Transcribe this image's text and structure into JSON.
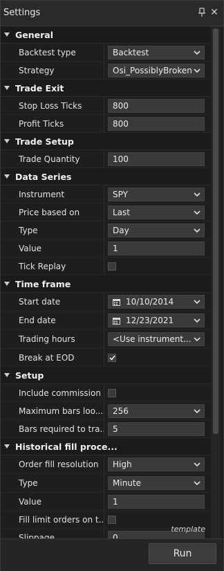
{
  "window": {
    "title": "Settings"
  },
  "sections": {
    "general": {
      "title": "General",
      "backtest_type": {
        "label": "Backtest type",
        "value": "Backtest"
      },
      "strategy": {
        "label": "Strategy",
        "value": "Osi_PossiblyBroken"
      }
    },
    "trade_exit": {
      "title": "Trade Exit",
      "stop_loss": {
        "label": "Stop Loss Ticks",
        "value": "800"
      },
      "profit": {
        "label": "Profit Ticks",
        "value": "800"
      }
    },
    "trade_setup": {
      "title": "Trade Setup",
      "quantity": {
        "label": "Trade Quantity",
        "value": "100"
      }
    },
    "data_series": {
      "title": "Data Series",
      "instrument": {
        "label": "Instrument",
        "value": "SPY"
      },
      "price_based_on": {
        "label": "Price based on",
        "value": "Last"
      },
      "type": {
        "label": "Type",
        "value": "Day"
      },
      "value": {
        "label": "Value",
        "value": "1"
      },
      "tick_replay": {
        "label": "Tick Replay",
        "checked": false
      }
    },
    "time_frame": {
      "title": "Time frame",
      "start_date": {
        "label": "Start date",
        "value": "10/10/2014"
      },
      "end_date": {
        "label": "End date",
        "value": "12/23/2021"
      },
      "trading_hours": {
        "label": "Trading hours",
        "value": "<Use instrument..."
      },
      "break_eod": {
        "label": "Break at EOD",
        "checked": true
      }
    },
    "setup": {
      "title": "Setup",
      "include_commission": {
        "label": "Include commission",
        "checked": false
      },
      "max_bars": {
        "label": "Maximum bars loo...",
        "value": "256"
      },
      "bars_required": {
        "label": "Bars required to tra...",
        "value": "5"
      }
    },
    "historical": {
      "title": "Historical fill proce...",
      "order_fill_resolution": {
        "label": "Order fill resolution",
        "value": "High"
      },
      "type": {
        "label": "Type",
        "value": "Minute"
      },
      "value": {
        "label": "Value",
        "value": "1"
      },
      "fill_limit": {
        "label": "Fill limit orders on t...",
        "checked": false
      },
      "slippage": {
        "label": "Slippage",
        "value": "0"
      }
    }
  },
  "template_link": "template",
  "footer": {
    "run_label": "Run"
  }
}
